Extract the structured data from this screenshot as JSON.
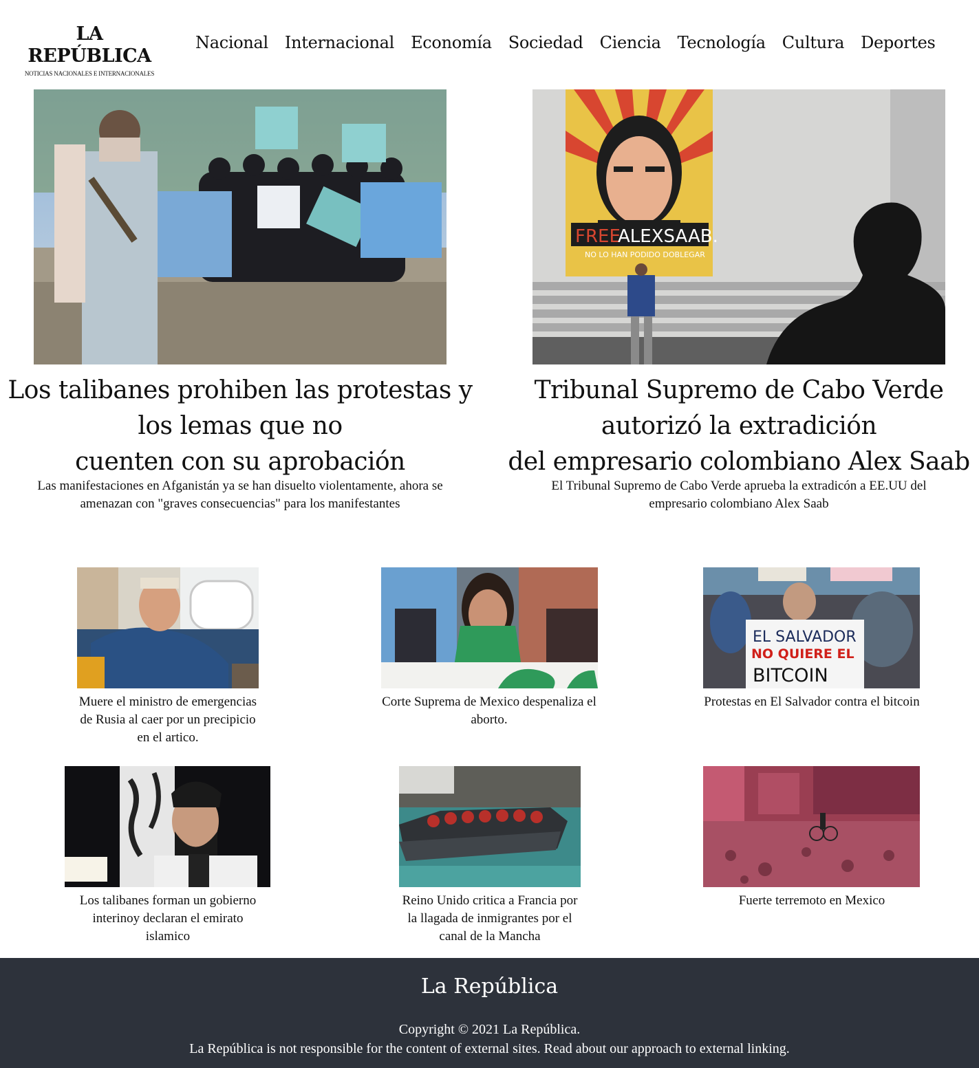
{
  "header": {
    "logo_title": "LA REPÚBLICA",
    "logo_subtitle": "NOTICIAS NACIONALES E INTERNACIONALES",
    "nav": [
      "Nacional",
      "Internacional",
      "Economía",
      "Sociedad",
      "Ciencia",
      "Tecnología",
      "Cultura",
      "Deportes"
    ]
  },
  "hero": [
    {
      "title_lines": [
        "Los talibanes prohiben las protestas y",
        "los lemas que no",
        "cuenten con su aprobación"
      ],
      "subtitle_lines": [
        "Las manifestaciones en Afganistán ya se han disuelto violentamente, ahora se",
        "amenazan con \"graves consecuencias\" para los manifestantes"
      ],
      "image": "taliban-protest-photo"
    },
    {
      "title_lines": [
        "Tribunal Supremo de Cabo Verde",
        "autorizó la extradición",
        "del empresario colombiano Alex Saab"
      ],
      "subtitle_lines": [
        "El Tribunal Supremo de Cabo Verde aprueba la extradicón a EE.UU del",
        "empresario colombiano Alex Saab"
      ],
      "image": "alex-saab-mural-photo",
      "poster_text": [
        "FREE",
        "ALEXSAAB.",
        "NO LO HAN PODIDO DOBLEGAR"
      ]
    }
  ],
  "cards": [
    {
      "caption_lines": [
        "Muere el ministro de emergencias",
        "de Rusia al caer por un precipicio",
        "en el artico."
      ],
      "image": "russian-minister-photo"
    },
    {
      "caption_lines": [
        "Corte Suprema de Mexico despenaliza el",
        "aborto."
      ],
      "image": "green-scarf-protester-photo"
    },
    {
      "caption_lines": [
        "Protestas en El Salvador contra el bitcoin"
      ],
      "image": "bitcoin-protest-photo",
      "sign_text": [
        "EL SALVADOR",
        "NO QUIERE EL",
        "BITCOIN"
      ]
    },
    {
      "caption_lines": [
        "Los talibanes forman un gobierno",
        "interinoy declaran el emirato",
        "islamico"
      ],
      "image": "taliban-spokesman-photo"
    },
    {
      "caption_lines": [
        "Reino Unido critica a Francia por",
        "la llagada de inmigrantes por el",
        "canal de la Mancha"
      ],
      "image": "migrant-boat-photo"
    },
    {
      "caption_lines": [
        "Fuerte terremoto en Mexico"
      ],
      "image": "earthquake-street-photo"
    }
  ],
  "footer": {
    "title": "La República",
    "copyright": "Copyright © 2021 La República.",
    "note_prefix": "La República is not responsible for the content of external sites. ",
    "note_link": "Read about our approach to external linking."
  },
  "colors": {
    "footer_bg": "#2d323b",
    "text": "#111111"
  }
}
